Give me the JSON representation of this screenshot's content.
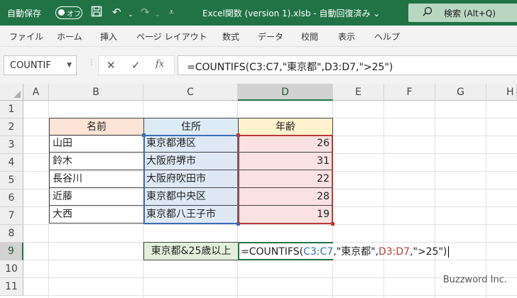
{
  "titlebar": {
    "autosave_label": "自動保存",
    "toggle_label": "オフ",
    "document_title": "Excel関数 (version 1).xlsb  -  自動回復済み  ⌄",
    "search_placeholder": "検索 (Alt+Q)"
  },
  "menu": [
    "ファイル",
    "ホーム",
    "挿入",
    "ページ レイアウト",
    "数式",
    "データ",
    "校閲",
    "表示",
    "ヘルプ"
  ],
  "namebox": {
    "value": "COUNTIF"
  },
  "formula_bar": {
    "value": "=COUNTIFS(C3:C7,\"東京都\",D3:D7,\">25\")"
  },
  "columns": [
    "A",
    "B",
    "C",
    "D",
    "E",
    "F",
    "G",
    "H"
  ],
  "rows": [
    "1",
    "2",
    "3",
    "4",
    "5",
    "6",
    "7",
    "8",
    "9",
    "10",
    "11"
  ],
  "table": {
    "headers": [
      "名前",
      "住所",
      "年齢"
    ],
    "rows": [
      [
        "山田",
        "東京都港区",
        "26"
      ],
      [
        "鈴木",
        "大阪府堺市",
        "31"
      ],
      [
        "長谷川",
        "大阪府吹田市",
        "22"
      ],
      [
        "近藤",
        "東京都中央区",
        "28"
      ],
      [
        "大西",
        "東京都八王子市",
        "19"
      ]
    ]
  },
  "criteria_label": "東京都&25歳以上",
  "editing_cell": {
    "p1": "=COUNTIFS(",
    "p2": "C3:C7",
    "p3": ",\"東京都\",",
    "p4": "D3:D7",
    "p5": ",\">25\")"
  },
  "watermark": "Buzzword Inc.",
  "colors": {
    "excel_green": "#217346",
    "range_blue": "#3a6fb5",
    "range_red": "#b83a3a",
    "header_b_fill": "#fce4d6",
    "header_c_fill": "#ddebf7",
    "header_d_fill": "#fff2cc",
    "criteria_fill": "#e2efda"
  }
}
